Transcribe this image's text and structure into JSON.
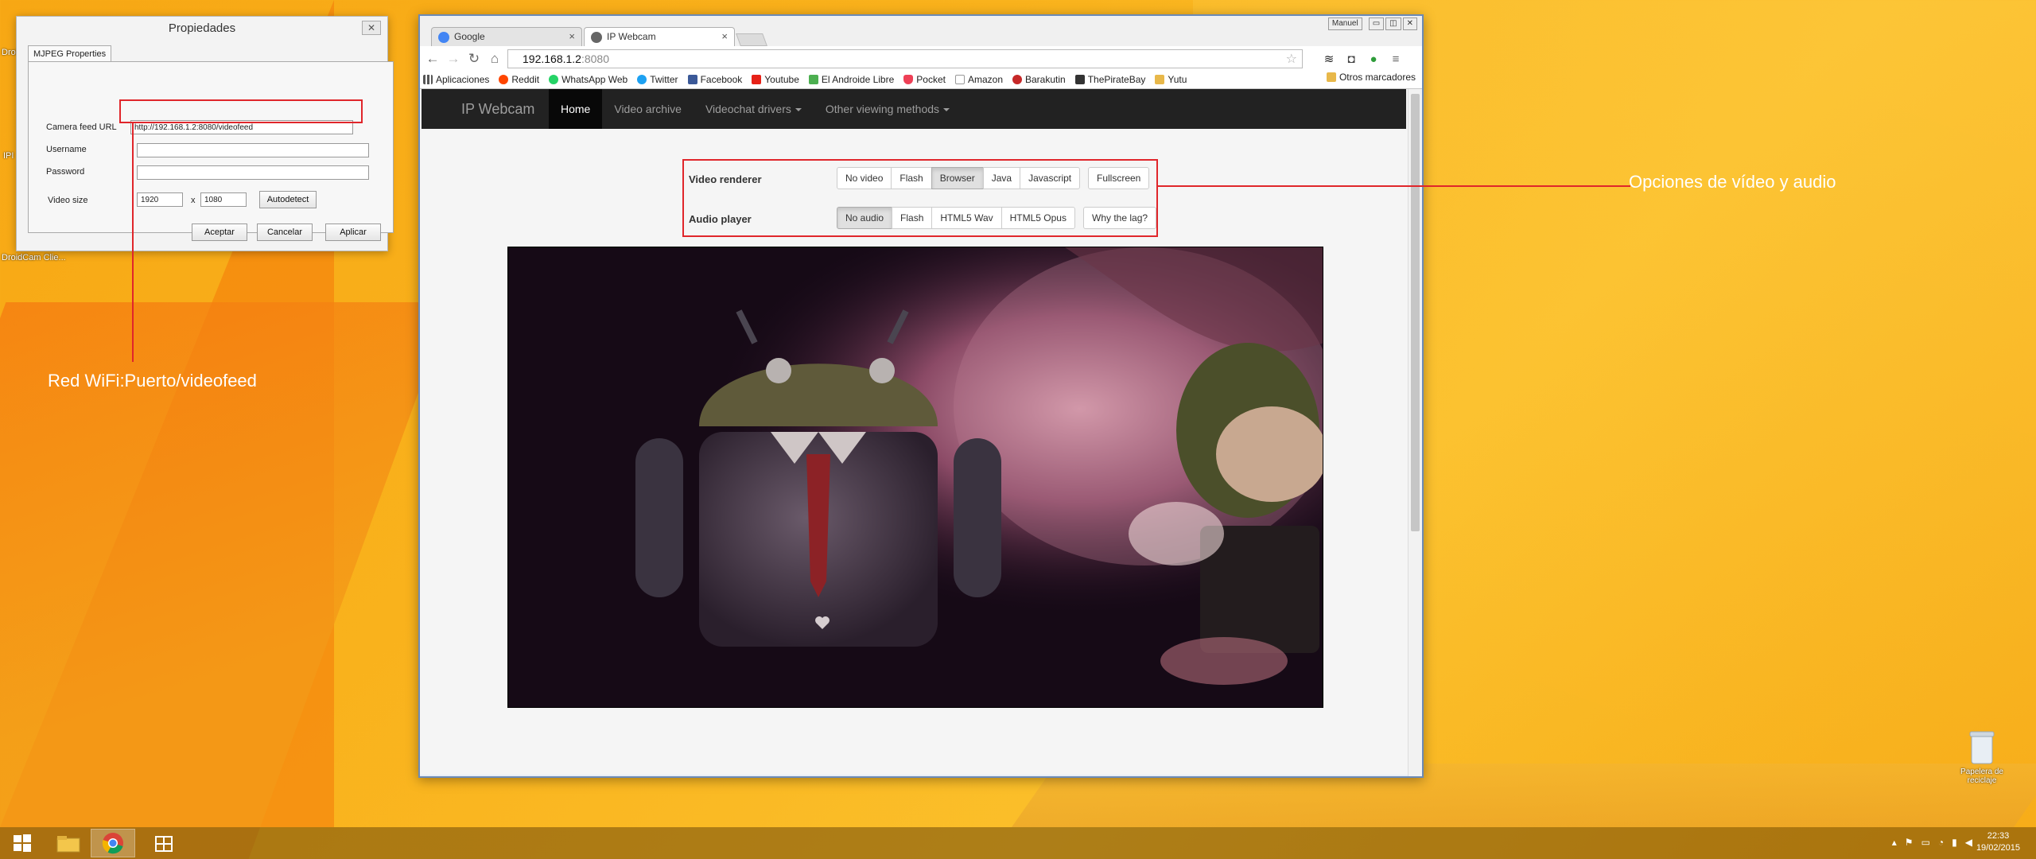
{
  "desktop": {
    "icon_label_1": "Droi",
    "icon_label_2": "IPI",
    "icon_label_3": "DroidCam Clie...",
    "recycle_label": "Papelera de reciclaje"
  },
  "dialog": {
    "title": "Propiedades",
    "close_glyph": "✕",
    "tab": "MJPEG Properties",
    "camera_feed_url_label": "Camera feed URL",
    "camera_feed_url_value": "http://192.168.1.2:8080/videofeed",
    "username_label": "Username",
    "username_value": "",
    "password_label": "Password",
    "password_value": "",
    "video_size_label": "Video size",
    "width_value": "1920",
    "x_sep": "x",
    "height_value": "1080",
    "autodetect": "Autodetect",
    "ok": "Aceptar",
    "cancel": "Cancelar",
    "apply": "Aplicar"
  },
  "annotations": {
    "left": "Red WiFi:Puerto/videofeed",
    "right": "Opciones de vídeo y audio",
    "color": "#e0262b"
  },
  "browser": {
    "tabs": [
      {
        "title": "Google",
        "icon": "google-icon"
      },
      {
        "title": "IP Webcam",
        "icon": "webcam-icon"
      }
    ],
    "tab_close_glyph": "×",
    "window_controls": {
      "user": "Manuel",
      "minimize": "▭",
      "restore": "◫",
      "close": "✕"
    },
    "url_host": "192.168.1.2",
    "url_port": ":8080",
    "bookmarks": [
      {
        "label": "Aplicaciones",
        "icon": "apps-icon",
        "color": "#555"
      },
      {
        "label": "Reddit",
        "icon": "reddit-icon",
        "color": "#ff4500"
      },
      {
        "label": "WhatsApp Web",
        "icon": "whatsapp-icon",
        "color": "#25d366"
      },
      {
        "label": "Twitter",
        "icon": "twitter-icon",
        "color": "#1da1f2"
      },
      {
        "label": "Facebook",
        "icon": "facebook-icon",
        "color": "#3b5998"
      },
      {
        "label": "Youtube",
        "icon": "youtube-icon",
        "color": "#e62117"
      },
      {
        "label": "El Androide Libre",
        "icon": "android-icon",
        "color": "#4caf50"
      },
      {
        "label": "Pocket",
        "icon": "pocket-icon",
        "color": "#ee4056"
      },
      {
        "label": "Amazon",
        "icon": "amazon-icon",
        "color": "#222"
      },
      {
        "label": "Barakutin",
        "icon": "barakutin-icon",
        "color": "#c62828"
      },
      {
        "label": "ThePirateBay",
        "icon": "pirate-icon",
        "color": "#333"
      },
      {
        "label": "Yutu",
        "icon": "folder-icon",
        "color": "#e8b84a"
      }
    ],
    "other_bookmarks": "Otros marcadores"
  },
  "page": {
    "brand": "IP Webcam",
    "nav": [
      {
        "label": "Home",
        "active": true,
        "dropdown": false
      },
      {
        "label": "Video archive",
        "active": false,
        "dropdown": false
      },
      {
        "label": "Videochat drivers",
        "active": false,
        "dropdown": true
      },
      {
        "label": "Other viewing methods",
        "active": false,
        "dropdown": true
      }
    ],
    "video_renderer_label": "Video renderer",
    "video_renderer_options": [
      {
        "label": "No video",
        "active": false
      },
      {
        "label": "Flash",
        "active": false
      },
      {
        "label": "Browser",
        "active": true
      },
      {
        "label": "Java",
        "active": false
      },
      {
        "label": "Javascript",
        "active": false
      }
    ],
    "fullscreen": "Fullscreen",
    "audio_player_label": "Audio player",
    "audio_player_options": [
      {
        "label": "No audio",
        "active": true
      },
      {
        "label": "Flash",
        "active": false
      },
      {
        "label": "HTML5 Wav",
        "active": false
      },
      {
        "label": "HTML5 Opus",
        "active": false
      }
    ],
    "why_lag": "Why the lag?"
  },
  "taskbar": {
    "time": "22:33",
    "date": "19/02/2015"
  }
}
